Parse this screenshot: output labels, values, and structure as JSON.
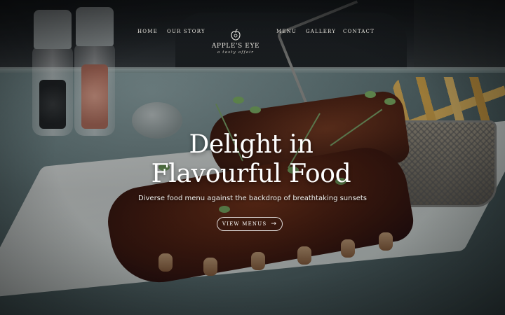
{
  "header": {
    "nav_left": [
      {
        "label": "HOME"
      },
      {
        "label": "OUR STORY"
      }
    ],
    "logo": {
      "name": "APPLE'S EYE",
      "tagline": "a tasty affair",
      "icon": "apple-icon"
    },
    "nav_right": [
      {
        "label": "MENU"
      },
      {
        "label": "GALLERY"
      },
      {
        "label": "CONTACT"
      }
    ]
  },
  "hero": {
    "title": "Delight in Flavourful Food",
    "subtitle": "Diverse food menu against the backdrop of breathtaking sunsets",
    "cta_label": "VIEW MENUS",
    "cta_icon": "arrow-right-icon"
  },
  "background": {
    "description_icon": "food-photo",
    "colors": {
      "text": "#ffffff",
      "nav_text": "#e6e3dc",
      "overlay": "#0a0c0e"
    }
  }
}
